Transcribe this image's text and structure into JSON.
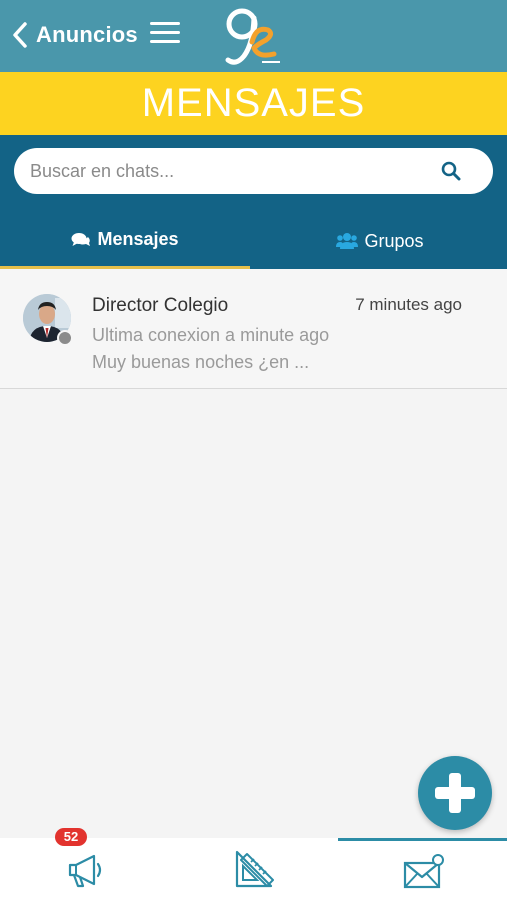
{
  "header": {
    "back_label": "Anuncios",
    "bar_color": "#4a97ab"
  },
  "banner": {
    "title": "MENSAJES",
    "color": "#fdd320"
  },
  "search": {
    "placeholder": "Buscar en chats...",
    "value": ""
  },
  "tabs": [
    {
      "label": "Mensajes",
      "icon": "comments-icon",
      "active": true
    },
    {
      "label": "Grupos",
      "icon": "users-icon",
      "active": false
    }
  ],
  "chats": [
    {
      "name": "Director Colegio",
      "time": "7 minutes ago",
      "status": "Ultima conexion a minute ago",
      "preview": "Muy buenas noches ¿en ..."
    }
  ],
  "fab": {
    "icon": "plus-icon"
  },
  "bottom_nav": [
    {
      "icon": "megaphone-icon",
      "badge": "52",
      "active": false
    },
    {
      "icon": "ruler-triangle-icon",
      "active": false
    },
    {
      "icon": "envelope-icon",
      "active": true
    }
  ],
  "colors": {
    "accent": "#2c8ca6",
    "search_panel": "#136386",
    "badge": "#e2332e"
  }
}
